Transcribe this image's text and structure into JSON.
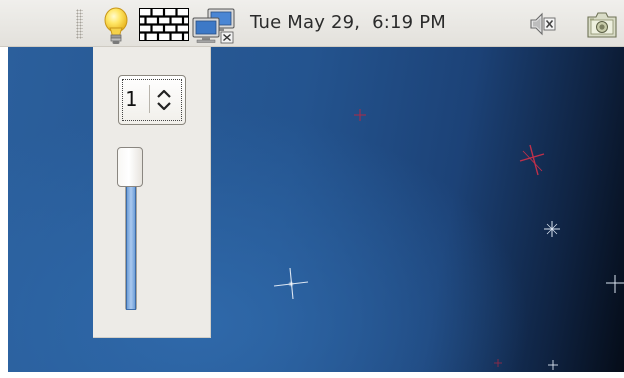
{
  "panel": {
    "clock_text": "Tue May 29,  6:19 PM",
    "icons": [
      "brightness-applet-icon",
      "workspace-switcher-icon",
      "network-monitor-icon",
      "volume-muted-icon",
      "screenshot-icon"
    ]
  },
  "brightness_popup": {
    "spin_value": "1",
    "slider_level_fraction": 1.0
  },
  "colors": {
    "panel": "#e9e7e3",
    "popup": "#edebe7",
    "desktop": "#24548f",
    "slider_fill": "#7eabe3"
  }
}
